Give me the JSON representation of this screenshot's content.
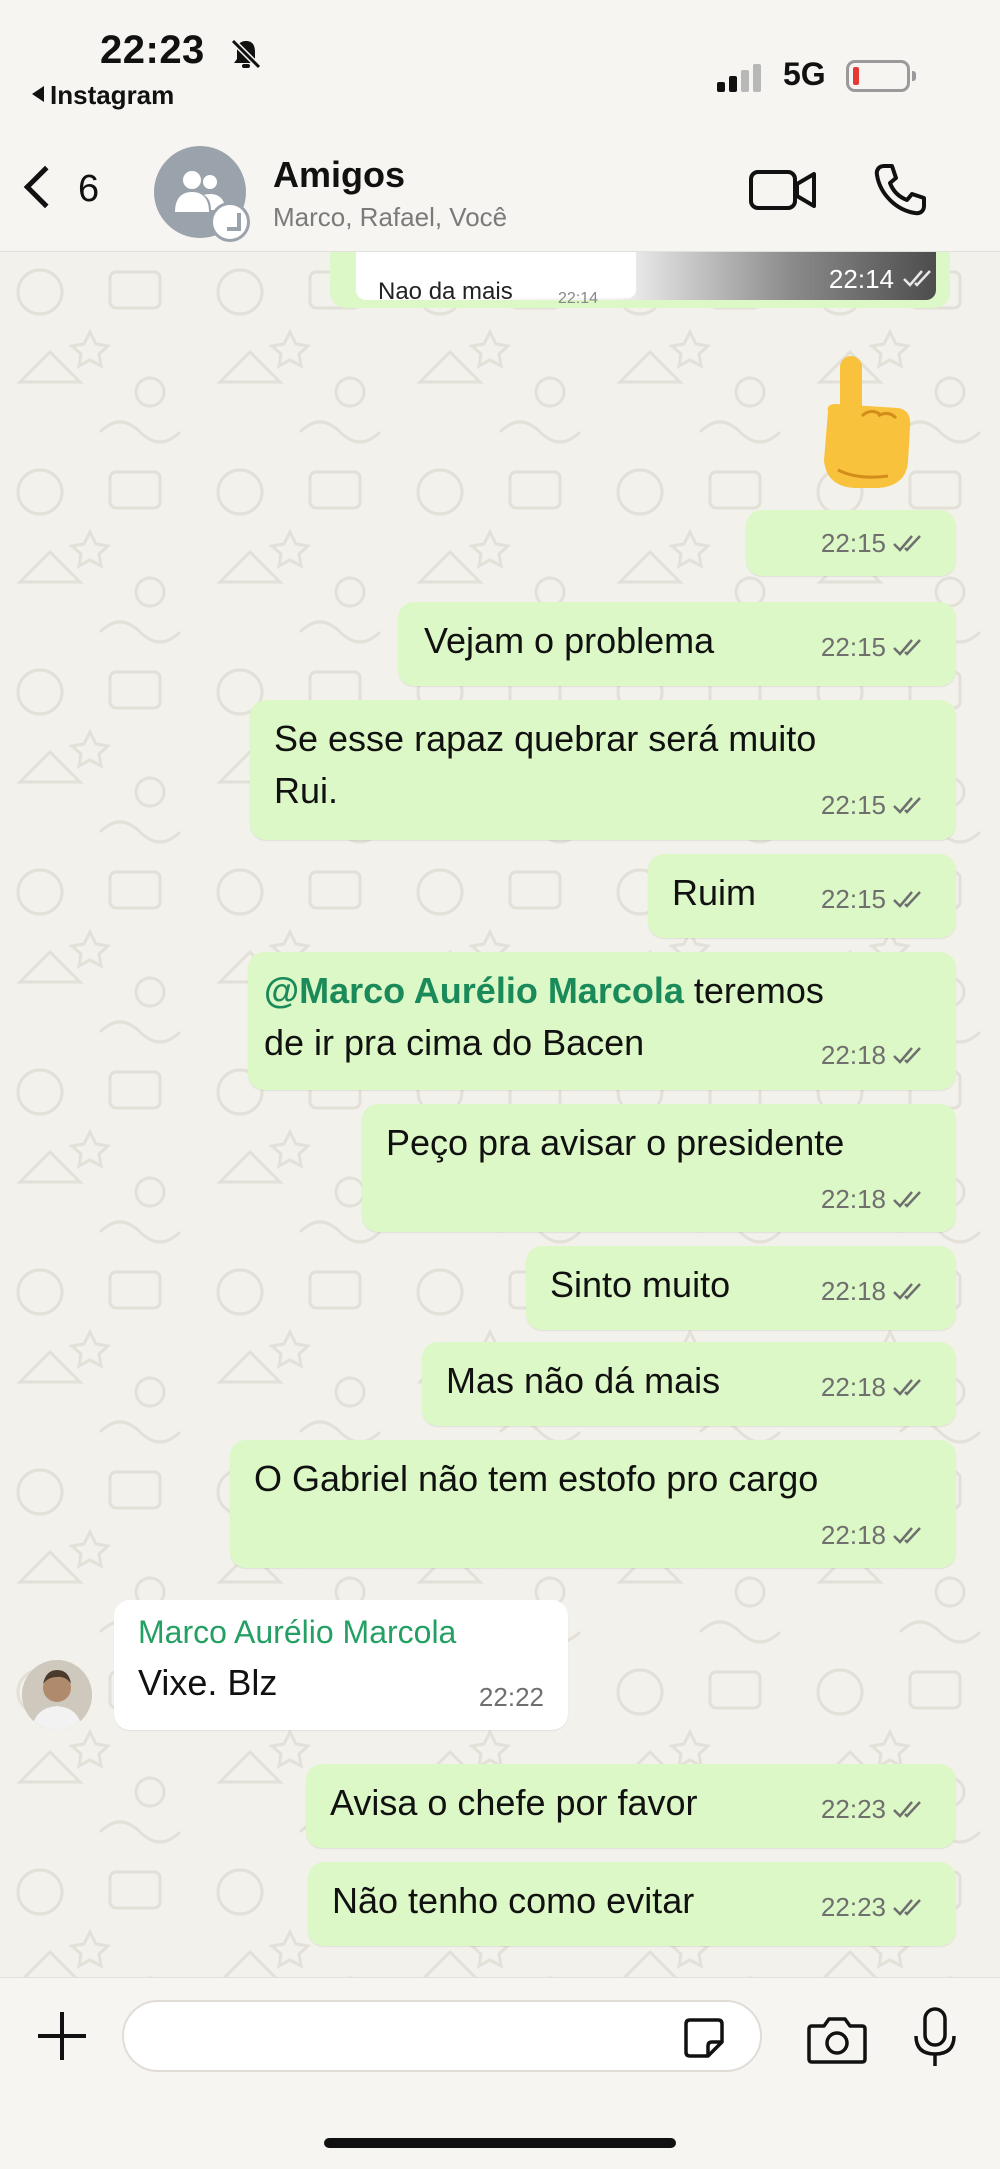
{
  "status_bar": {
    "time": "22:23",
    "back_app": "Instagram",
    "network": "5G"
  },
  "header": {
    "back_count": "6",
    "title": "Amigos",
    "members": "Marco, Rafael, Você"
  },
  "messages": [
    {
      "type": "image",
      "quoted_text": "Nao da mais",
      "quoted_time": "22:14",
      "time": "22:14"
    },
    {
      "type": "emoji",
      "emoji": "pointing-up-hand",
      "time": "22:15"
    },
    {
      "type": "out",
      "text": "Vejam o problema",
      "time": "22:15"
    },
    {
      "type": "out",
      "lines": [
        "Se esse rapaz quebrar será muito",
        "Rui."
      ],
      "time": "22:15"
    },
    {
      "type": "out",
      "text": "Ruim",
      "time": "22:15"
    },
    {
      "type": "out",
      "mention": "@Marco Aurélio Marcola",
      "rest": " teremos",
      "line2": "de ir pra cima do Bacen",
      "time": "22:18"
    },
    {
      "type": "out",
      "text": "Peço pra avisar o presidente",
      "time": "22:18"
    },
    {
      "type": "out",
      "text": "Sinto muito",
      "time": "22:18"
    },
    {
      "type": "out",
      "text": "Mas não dá mais",
      "time": "22:18"
    },
    {
      "type": "out",
      "text": "O Gabriel não tem estofo pro cargo",
      "time": "22:18"
    },
    {
      "type": "in",
      "sender": "Marco Aurélio Marcola",
      "text": "Vixe. Blz",
      "time": "22:22"
    },
    {
      "type": "out",
      "text": "Avisa o chefe por favor",
      "time": "22:23"
    },
    {
      "type": "out",
      "text": "Não tenho como evitar",
      "time": "22:23"
    }
  ],
  "composer": {
    "value": ""
  },
  "colors": {
    "outgoing": "#dcf8c6",
    "incoming": "#ffffff",
    "sender_name": "#25a064",
    "mention": "#1b8a5a",
    "battery_low": "#e53935"
  }
}
